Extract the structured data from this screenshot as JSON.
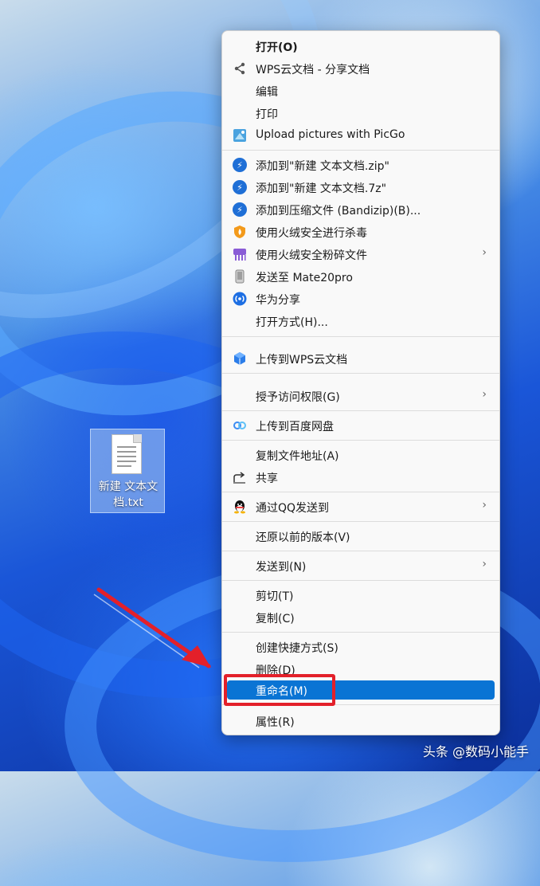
{
  "desktop": {
    "file_label": "新建 文本文档.txt"
  },
  "context_menu": {
    "items": [
      {
        "label": "打开(O)",
        "icon": "none",
        "bold": true
      },
      {
        "label": "WPS云文档 - 分享文档",
        "icon": "share-icon"
      },
      {
        "label": "编辑",
        "icon": "none"
      },
      {
        "label": "打印",
        "icon": "none"
      },
      {
        "label": "Upload pictures with PicGo",
        "icon": "picgo-icon"
      },
      {
        "label": "添加到\"新建 文本文档.zip\"",
        "icon": "bandizip-icon"
      },
      {
        "label": "添加到\"新建 文本文档.7z\"",
        "icon": "bandizip-icon"
      },
      {
        "label": "添加到压缩文件 (Bandizip)(B)...",
        "icon": "bandizip-icon"
      },
      {
        "label": "使用火绒安全进行杀毒",
        "icon": "huorong-shield-icon"
      },
      {
        "label": "使用火绒安全粉碎文件",
        "icon": "shredder-icon",
        "submenu": true
      },
      {
        "label": "发送至 Mate20pro",
        "icon": "phone-icon"
      },
      {
        "label": "华为分享",
        "icon": "huawei-share-icon"
      },
      {
        "label": "打开方式(H)...",
        "icon": "none"
      },
      {
        "label": "上传到WPS云文档",
        "icon": "wps-cloud-icon"
      },
      {
        "label": "授予访问权限(G)",
        "icon": "none",
        "submenu": true
      },
      {
        "label": "上传到百度网盘",
        "icon": "baidu-netdisk-icon"
      },
      {
        "label": "复制文件地址(A)",
        "icon": "none"
      },
      {
        "label": "共享",
        "icon": "share-arrow-icon"
      },
      {
        "label": "通过QQ发送到",
        "icon": "qq-icon",
        "submenu": true
      },
      {
        "label": "还原以前的版本(V)",
        "icon": "none"
      },
      {
        "label": "发送到(N)",
        "icon": "none",
        "submenu": true
      },
      {
        "label": "剪切(T)",
        "icon": "none"
      },
      {
        "label": "复制(C)",
        "icon": "none"
      },
      {
        "label": "创建快捷方式(S)",
        "icon": "none"
      },
      {
        "label": "删除(D)",
        "icon": "none"
      },
      {
        "label": "重命名(M)",
        "icon": "none",
        "highlighted": true
      },
      {
        "label": "属性(R)",
        "icon": "none"
      }
    ],
    "submenu_arrow": "›"
  },
  "watermark": "头条 @数码小能手",
  "colors": {
    "highlight": "#0a74d4",
    "annotation_red": "#e3202a"
  }
}
